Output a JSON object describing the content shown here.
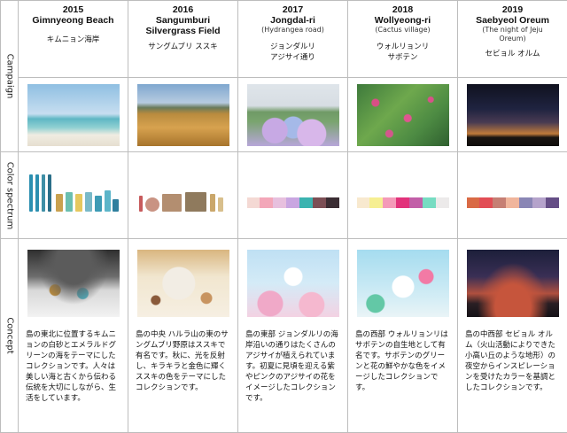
{
  "row_labels": {
    "campaign": "Campaign",
    "color": "Color spectrum",
    "concept": "Concept"
  },
  "columns": [
    {
      "year": "2015",
      "name": "Gimnyeong Beach",
      "english": "",
      "japanese": [
        "キムニョン海岸"
      ],
      "description": "島の東北に位置するキムニョンの白砂とエメラルドグリーンの海をテーマにしたコレクションです。人々は美しい海と古くから伝わる伝統を大切にしながら、生活をしています。",
      "swatches": []
    },
    {
      "year": "2016",
      "name": "Sangumburi Silvergrass Field",
      "english": "",
      "japanese": [
        "サングムブリ ススキ"
      ],
      "description": "島の中央 ハルラ山の東のサングムブリ野原はススキで有名です。秋に、光を反射し、キラキラと金色に輝くススキの色をテーマにしたコレクションです。",
      "swatches": []
    },
    {
      "year": "2017",
      "name": "Jongdal-ri",
      "english": "(Hydrangea road)",
      "japanese": [
        "ジョンダルリ",
        "アジサイ通り"
      ],
      "description": "島の東部 ジョンダルリの海岸沿いの通りはたくさんのアジサイが植えられています。初夏に見頃を迎える紫やピンクのアジサイの花をイメージしたコレクションです。",
      "swatches": [
        "#f4d9d4",
        "#f3a7b9",
        "#e7c0de",
        "#c9a6e1",
        "#3bb3b0",
        "#7c4f55",
        "#3b2d33"
      ]
    },
    {
      "year": "2018",
      "name": "Wollyeong-ri",
      "english": "(Cactus village)",
      "japanese": [
        "ウォルリョンリ",
        "サボテン"
      ],
      "description": "島の西部 ウォルリョンリはサボテンの自生地として有名です。サボテンのグリーンと花の鮮やかな色をイメージしたコレクションです。",
      "swatches": [
        "#f8e9cf",
        "#f6ef92",
        "#f49ab8",
        "#e2327b",
        "#c25fa8",
        "#77dcc2",
        "#eceaea"
      ]
    },
    {
      "year": "2019",
      "name": "Saebyeol Oreum",
      "english": "(The night of Jeju Oreum)",
      "japanese": [
        "セビョル オルム"
      ],
      "description": "島の中西部 セビョル オルム（火山活動によりできた小高い丘のような地形）の夜空からインスピレーションを受けたカラーを基調としたコレクションです。",
      "swatches": [
        "#d96a45",
        "#e24d55",
        "#c67f74",
        "#f0b59c",
        "#8a86b5",
        "#b5a3cb",
        "#654e86"
      ]
    }
  ]
}
